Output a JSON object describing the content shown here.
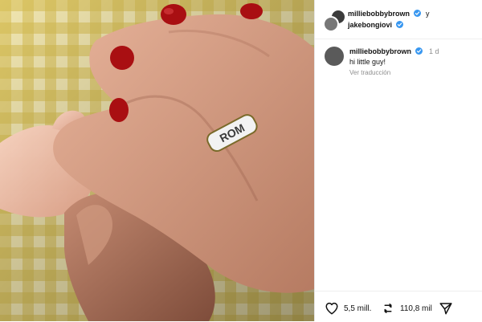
{
  "post": {
    "author1": "milliebobbybrown",
    "conjunction": "y",
    "author2": "jakebongiovi"
  },
  "comment": {
    "username": "milliebobbybrown",
    "time": "1 d",
    "text": "hi little guy!",
    "translate": "Ver traducción"
  },
  "actions": {
    "likes": "5,5 mill.",
    "reposts": "110,8 mil"
  },
  "icons": {
    "verified": "verified-icon",
    "like": "heart-icon",
    "repost": "repost-icon",
    "share": "send-icon"
  },
  "colors": {
    "verified": "#3897f0",
    "nail_polish": "#b01010",
    "gingham": "#d9c25a"
  },
  "image": {
    "description_visible_text": "ROM"
  }
}
